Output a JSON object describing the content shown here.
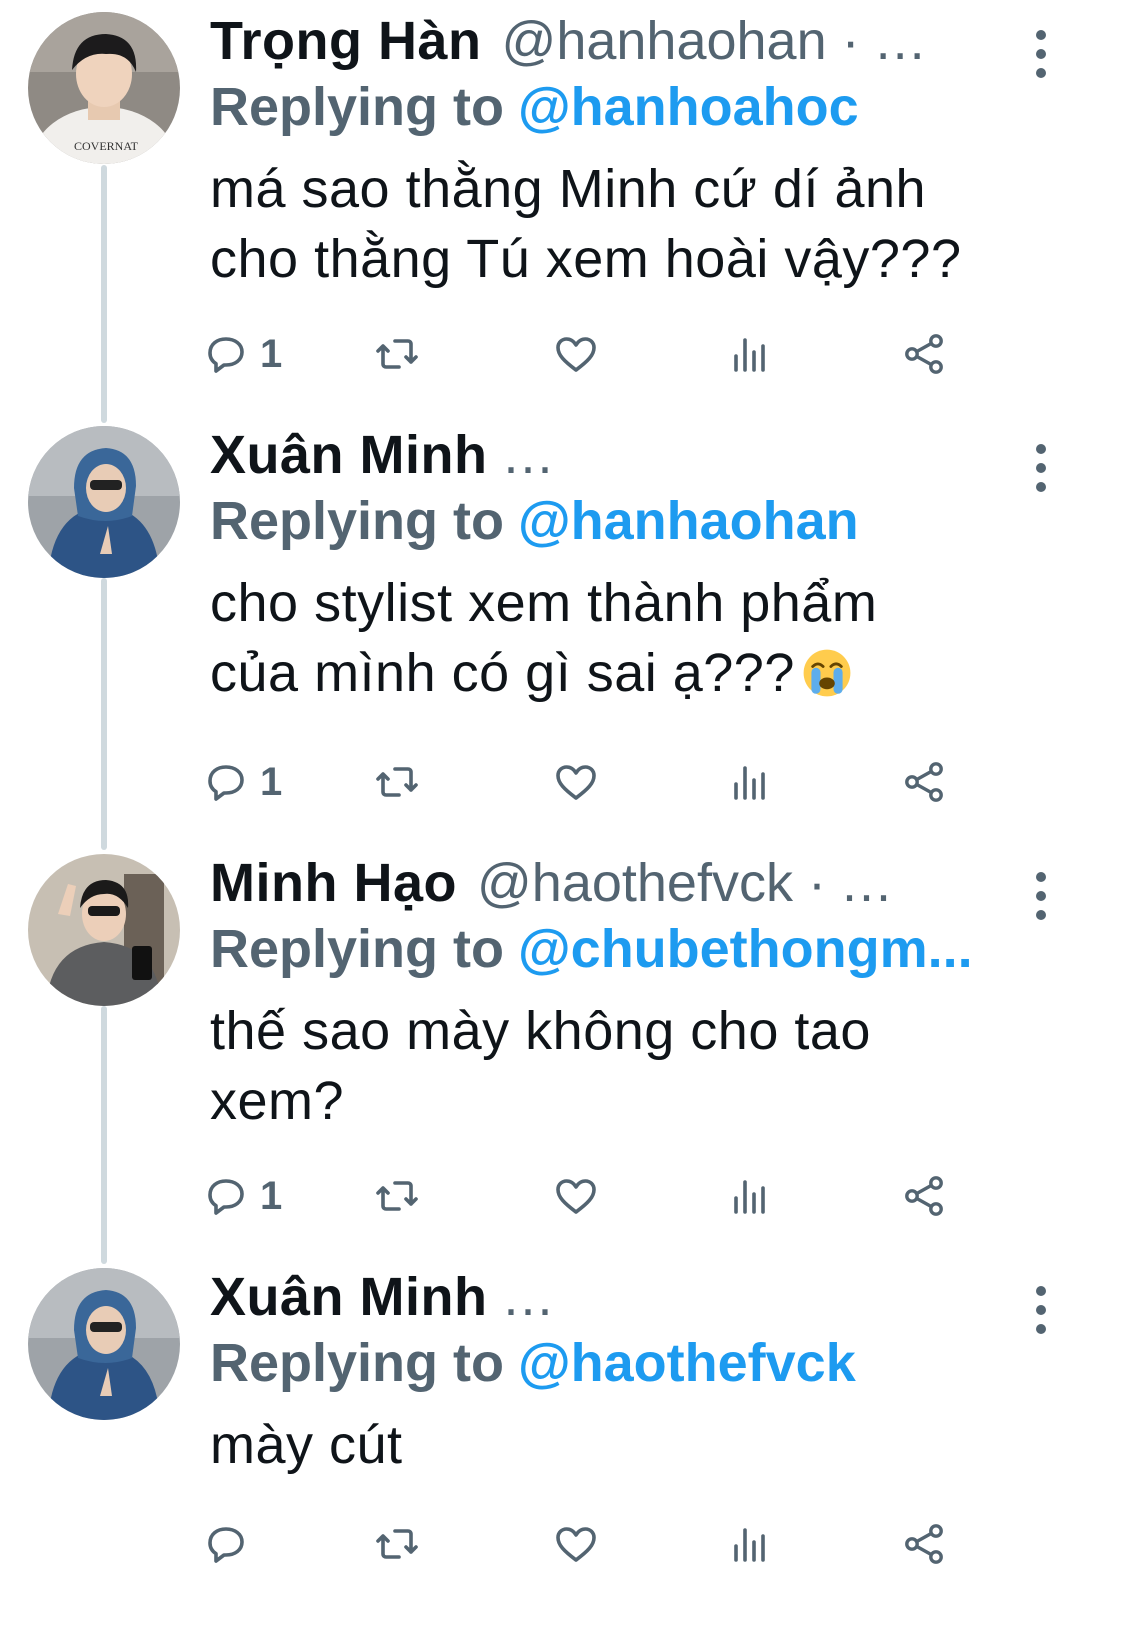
{
  "accent_color": "#1d9bf0",
  "muted_color": "#536471",
  "tweets": [
    {
      "display_name": "Trọng Hàn",
      "handle": "@hanhaohan ·",
      "ellipsis": "...",
      "replying_label": "Replying to",
      "replying_to": "@hanhoahoc",
      "text_lines": [
        "má sao thằng Minh cứ dí ảnh",
        "cho thằng Tú xem hoài vậy???"
      ],
      "reply_count": "1",
      "avatar": "avatar-white-shirt"
    },
    {
      "display_name": "Xuân Minh",
      "handle": "",
      "ellipsis": "...",
      "replying_label": "Replying to",
      "replying_to": "@hanhaohan",
      "text_lines": [
        "cho stylist xem thành phẩm",
        "của mình có gì sai ạ???"
      ],
      "emoji": "loudly-crying-face",
      "reply_count": "1",
      "avatar": "avatar-blue-hoodie"
    },
    {
      "display_name": "Minh Hạo",
      "handle": "@haothefvck ·",
      "ellipsis": "...",
      "replying_label": "Replying to",
      "replying_to": "@chubethongm...",
      "text_lines": [
        "thế sao mày không cho tao",
        "xem?"
      ],
      "reply_count": "1",
      "avatar": "avatar-grey-jacket"
    },
    {
      "display_name": "Xuân Minh",
      "handle": "",
      "ellipsis": "...",
      "replying_label": "Replying to",
      "replying_to": "@haothefvck",
      "text_lines": [
        "mày cút"
      ],
      "reply_count": "",
      "avatar": "avatar-blue-hoodie"
    }
  ],
  "icons": [
    "reply-icon",
    "retweet-icon",
    "like-icon",
    "views-icon",
    "share-icon",
    "more-icon"
  ]
}
